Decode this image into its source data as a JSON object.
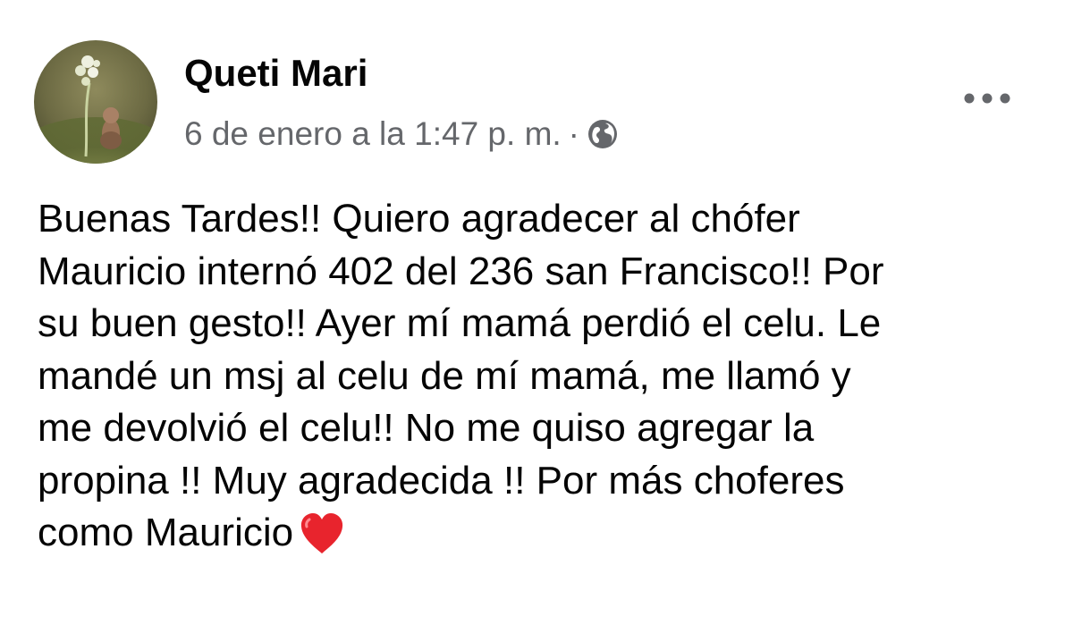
{
  "post": {
    "author_name": "Queti Mari",
    "timestamp": "6 de enero a la 1:47 p. m.",
    "separator": "·",
    "audience_icon": "globe-icon",
    "more_icon": "more-options-icon",
    "body_lines": [
      "Buenas Tardes!! Quiero agradecer al chófer",
      "Mauricio internó 402 del 236 san Francisco!! Por",
      "su buen gesto!! Ayer mí mamá perdió el celu. Le",
      "mandé un msj al celu de mí mamá, me llamó y",
      "me devolvió el celu!! No me quiso agregar la",
      "propina !! Muy agradecida !! Por más choferes",
      "como Mauricio"
    ],
    "trailing_emoji": "red-heart-icon"
  },
  "colors": {
    "primary_text": "#050505",
    "secondary_text": "#65676b",
    "icon_gray": "#65676b",
    "heart_red": "#e8242d",
    "background": "#ffffff"
  }
}
